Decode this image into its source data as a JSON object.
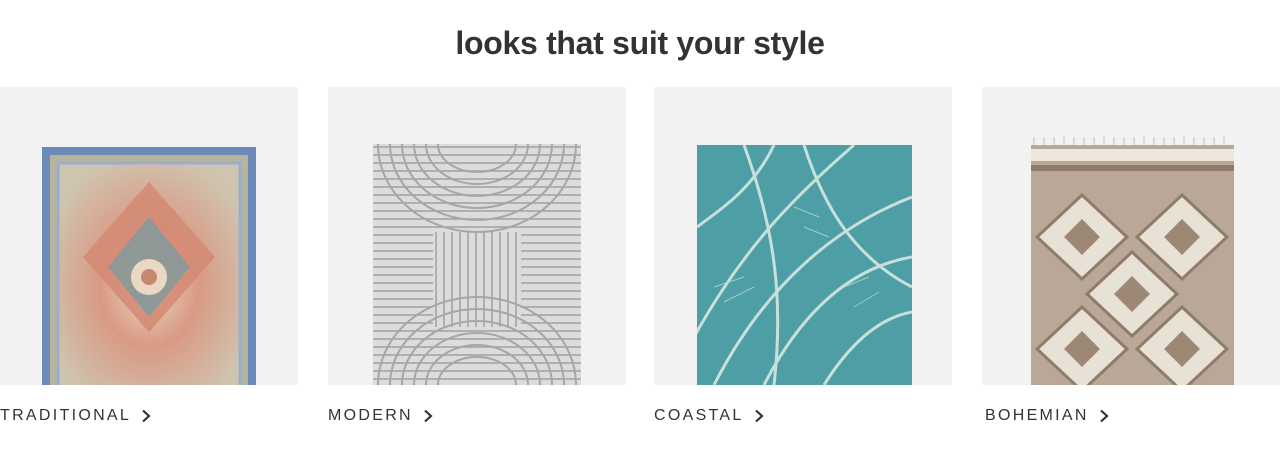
{
  "section": {
    "title": "looks that suit your style"
  },
  "styles": [
    {
      "label": "TRADITIONAL",
      "icon": "chevron-right-icon"
    },
    {
      "label": "MODERN",
      "icon": "chevron-right-icon"
    },
    {
      "label": "COASTAL",
      "icon": "chevron-right-icon"
    },
    {
      "label": "BOHEMIAN",
      "icon": "chevron-right-icon"
    }
  ],
  "colors": {
    "tile_background": "#f2f2f2",
    "text": "#333333"
  }
}
